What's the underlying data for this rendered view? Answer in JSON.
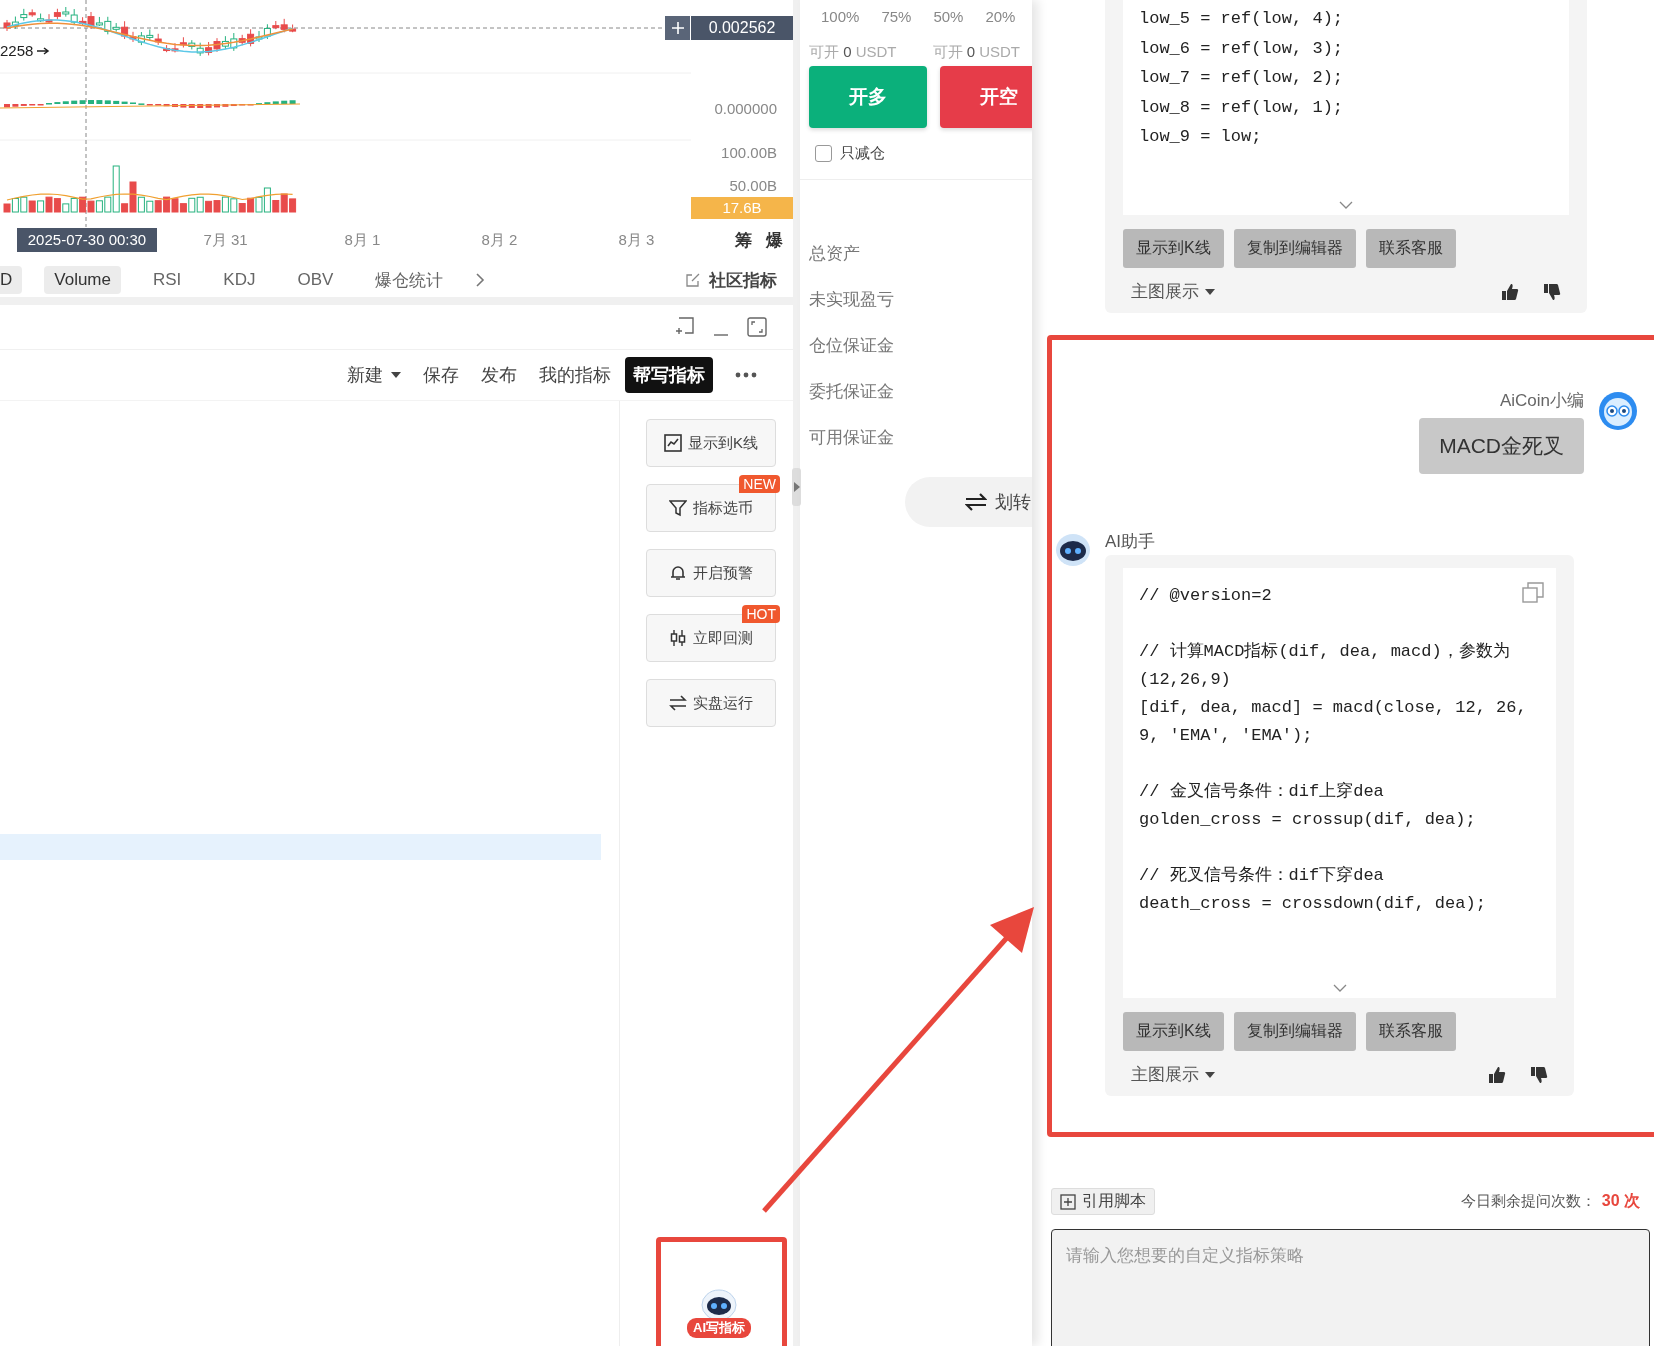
{
  "chart": {
    "price_marker": "2258",
    "crosshair_price": "0.002562",
    "axis_labels": [
      "0.000000",
      "100.00B",
      "50.00B"
    ],
    "volume_badge": "17.6B",
    "crosshair_time": "2025-07-30 00:30",
    "time_labels": [
      "7月 31",
      "8月 1",
      "8月 2",
      "8月 3"
    ],
    "side_labels": [
      "筹",
      "爆"
    ]
  },
  "indicator_tabs": [
    {
      "label": "D",
      "selected": true
    },
    {
      "label": "Volume",
      "selected": true
    },
    {
      "label": "RSI",
      "selected": false
    },
    {
      "label": "KDJ",
      "selected": false
    },
    {
      "label": "OBV",
      "selected": false
    },
    {
      "label": "爆仓统计",
      "selected": false
    }
  ],
  "community_link": "社区指标",
  "editor_toolbar": [
    {
      "label": "新建",
      "kind": "menu",
      "selected": false
    },
    {
      "label": "保存",
      "kind": "action",
      "selected": false
    },
    {
      "label": "发布",
      "kind": "action",
      "selected": false
    },
    {
      "label": "我的指标",
      "kind": "action",
      "selected": false
    },
    {
      "label": "帮写指标",
      "kind": "action",
      "selected": true
    }
  ],
  "side_actions": [
    {
      "label": "显示到K线"
    },
    {
      "label": "指标选币",
      "badge": "NEW"
    },
    {
      "label": "开启预警"
    },
    {
      "label": "立即回测",
      "badge": "HOT"
    },
    {
      "label": "实盘运行"
    }
  ],
  "ai_button": {
    "label": "AI写指标"
  },
  "order_panel": {
    "percentages": [
      "100%",
      "75%",
      "50%",
      "20%"
    ],
    "available": [
      {
        "prefix": "可开",
        "amount": "0",
        "unit": "USDT"
      },
      {
        "prefix": "可开",
        "amount": "0",
        "unit": "USDT"
      }
    ],
    "buttons": [
      {
        "label": "开多",
        "kind": "long"
      },
      {
        "label": "开空",
        "kind": "short"
      }
    ],
    "reduce_only": {
      "label": "只减仓",
      "checked": false
    },
    "account_rows": [
      "总资产",
      "未实现盈亏",
      "仓位保证金",
      "委托保证金",
      "可用保证金"
    ],
    "transfer": "划转"
  },
  "chat": {
    "messages": [
      {
        "kind": "assistant",
        "code_blocks": [
          [
            "low_5 = ref(low, 4);",
            "low_6 = ref(low, 3);",
            "low_7 = ref(low, 2);",
            "low_8 = ref(low, 1);",
            "low_9 = low;"
          ]
        ],
        "actions": [
          "显示到K线",
          "复制到编辑器",
          "联系客服"
        ],
        "display_mode": "主图展示"
      },
      {
        "kind": "user",
        "author": "AiCoin小编",
        "text": "MACD金死叉"
      },
      {
        "kind": "assistant",
        "author": "AI助手",
        "code_blocks": [
          [
            "// @version=2"
          ],
          [
            "// 计算MACD指标(dif, dea, macd)，参数为(12,26,9)",
            "[dif, dea, macd] = macd(close, 12, 26, 9, 'EMA', 'EMA');"
          ],
          [
            "// 金叉信号条件：dif上穿dea",
            "golden_cross = crossup(dif, dea);"
          ],
          [
            "// 死叉信号条件：dif下穿dea",
            "death_cross = crossdown(dif, dea);"
          ]
        ],
        "actions": [
          "显示到K线",
          "复制到编辑器",
          "联系客服"
        ],
        "display_mode": "主图展示"
      }
    ],
    "quote_button": "引用脚本",
    "quota_label": "今日剩余提问次数：",
    "quota_value": "30 次",
    "input": {
      "placeholder": "请输入您想要的自定义指标策略"
    }
  }
}
